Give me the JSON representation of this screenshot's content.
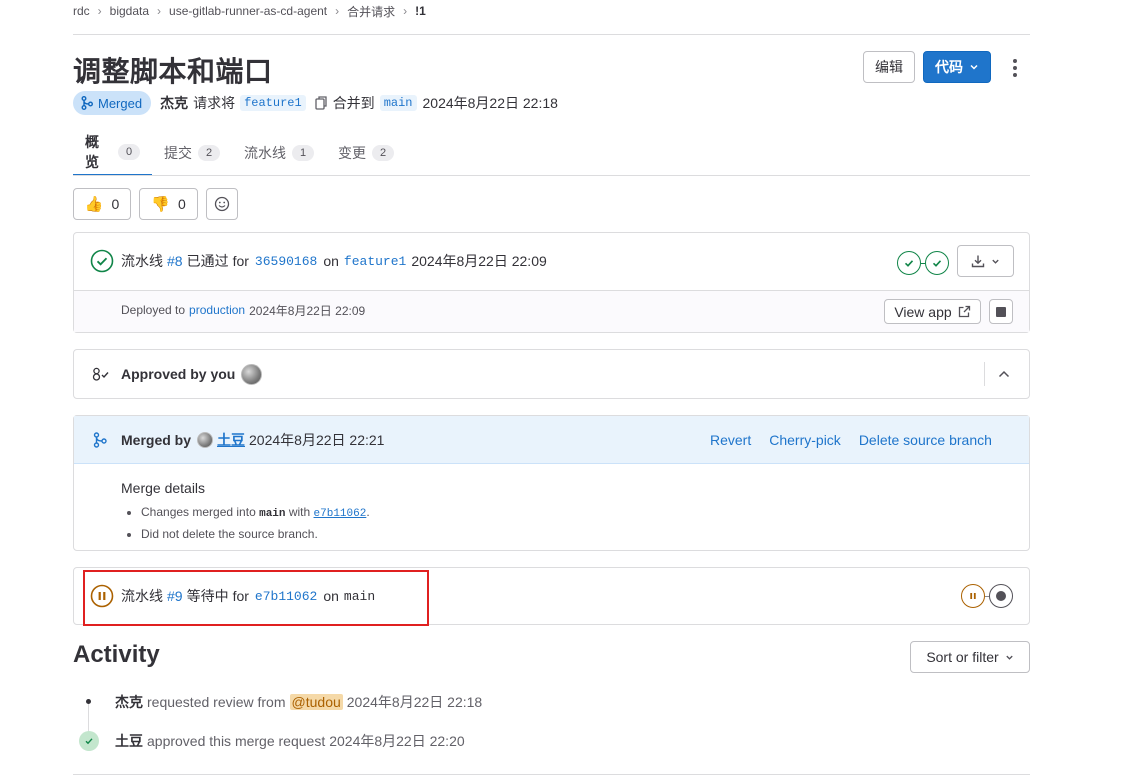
{
  "breadcrumb": [
    "rdc",
    "bigdata",
    "use-gitlab-runner-as-cd-agent",
    "合并请求",
    "!1"
  ],
  "title": "调整脚本和端口",
  "header": {
    "edit_label": "编辑",
    "code_label": "代码"
  },
  "meta": {
    "status": "Merged",
    "author": "杰克",
    "request_text": "请求将",
    "source_branch": "feature1",
    "merge_into": "合并到",
    "target_branch": "main",
    "date": "2024年8月22日 22:18"
  },
  "tabs": [
    {
      "label": "概览",
      "count": "0"
    },
    {
      "label": "提交",
      "count": "2"
    },
    {
      "label": "流水线",
      "count": "1"
    },
    {
      "label": "变更",
      "count": "2"
    }
  ],
  "awards": {
    "thumbs_up": "0",
    "thumbs_down": "0"
  },
  "pipeline8": {
    "prefix": "流水线",
    "id": "#8",
    "status": "已通过",
    "for": "for",
    "sha": "36590168",
    "on": "on",
    "branch": "feature1",
    "date": "2024年8月22日 22:09"
  },
  "deployment": {
    "label": "Deployed to",
    "env": "production",
    "date": "2024年8月22日 22:09",
    "view_app": "View app"
  },
  "approval": {
    "text": "Approved by you"
  },
  "merged": {
    "label": "Merged by",
    "user": "土豆",
    "date": "2024年8月22日 22:21",
    "revert": "Revert",
    "cherry_pick": "Cherry-pick",
    "delete_branch": "Delete source branch",
    "details_title": "Merge details",
    "detail1_prefix": "Changes merged into",
    "detail1_branch": "main",
    "detail1_with": "with",
    "detail1_sha": "e7b11062",
    "detail2": "Did not delete the source branch."
  },
  "pipeline9": {
    "prefix": "流水线",
    "id": "#9",
    "status": "等待中",
    "for": "for",
    "sha": "e7b11062",
    "on": "on",
    "branch": "main"
  },
  "activity": {
    "title": "Activity",
    "sort_label": "Sort or filter",
    "items": [
      {
        "user": "杰克",
        "action": "requested review from",
        "mention": "@tudou",
        "date": "2024年8月22日 22:18"
      },
      {
        "user": "土豆",
        "action": "approved this merge request",
        "date": "2024年8月22日 22:20"
      }
    ]
  },
  "colors": {
    "accent": "#1f75cb",
    "success": "#108548",
    "pending": "#ab6100",
    "highlight": "#e02020",
    "merged_bg": "#e9f3fc"
  }
}
